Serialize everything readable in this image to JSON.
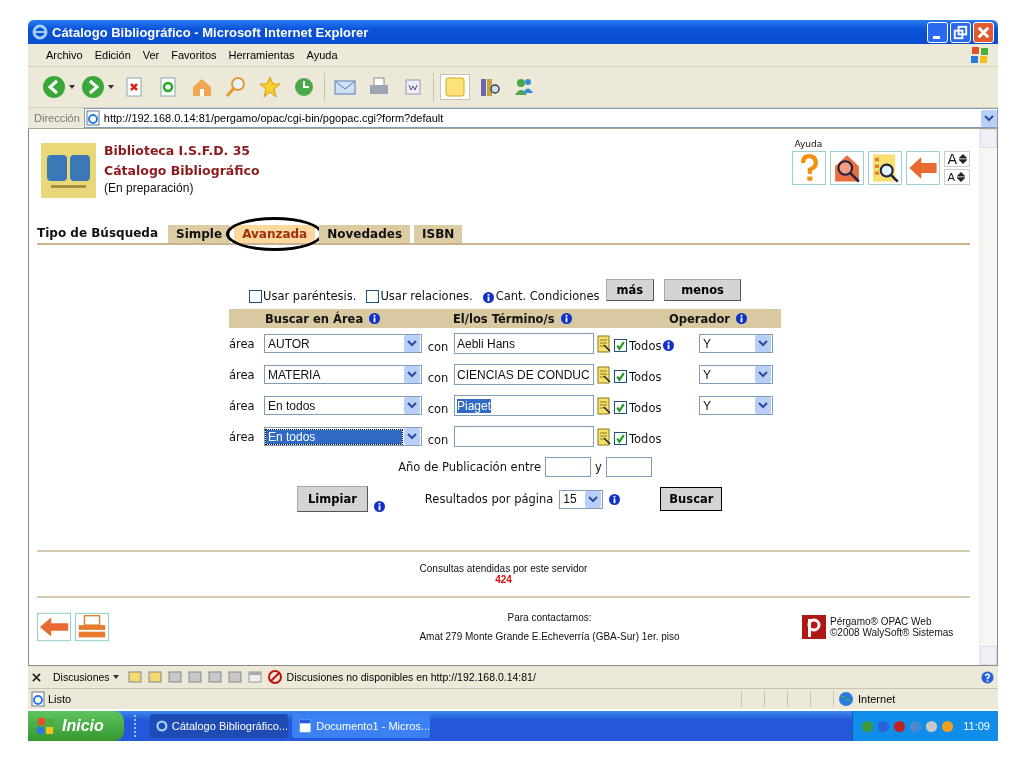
{
  "window": {
    "title": "Cátalogo Bibliográfico - Microsoft Internet Explorer"
  },
  "menu": [
    "Archivo",
    "Edición",
    "Ver",
    "Favoritos",
    "Herramientas",
    "Ayuda"
  ],
  "address": {
    "label": "Dirección",
    "url": "http://192.168.0.14:81/pergamo/opac/cgi-bin/pgopac.cgi?form?default"
  },
  "header": {
    "library": "Biblioteca I.S.F.D. 35",
    "catalog": "Cátalogo Bibliográfico",
    "note": "(En preparación)",
    "help_label": "Ayuda",
    "font_buttons": [
      "A",
      "A"
    ]
  },
  "search_type_label": "Tipo de Búsqueda",
  "tabs": [
    {
      "label": "Simple",
      "selected": false
    },
    {
      "label": "Avanzada",
      "selected": true
    },
    {
      "label": "Novedades",
      "selected": false
    },
    {
      "label": "ISBN",
      "selected": false
    }
  ],
  "options": [
    {
      "label": "Usar paréntesis.",
      "checked": false
    },
    {
      "label": "Usar relaciones.",
      "checked": false
    }
  ],
  "conditions_label": "Cant. Condiciones",
  "condition_buttons": [
    "más",
    "menos"
  ],
  "columns": [
    "Buscar en Área",
    "El/los Término/s",
    "Operador"
  ],
  "rows": [
    {
      "area_label": "área",
      "area": "AUTOR",
      "area_focused": false,
      "con": "con",
      "term": "Aebli Hans",
      "term_selected": false,
      "todos": "Todos",
      "todos_checked": true,
      "info": true,
      "operator": "Y"
    },
    {
      "area_label": "área",
      "area": "MATERIA",
      "area_focused": false,
      "con": "con",
      "term": "CIENCIAS DE CONDUC",
      "term_selected": false,
      "todos": "Todos",
      "todos_checked": true,
      "info": false,
      "operator": "Y"
    },
    {
      "area_label": "área",
      "area": "En todos",
      "area_focused": false,
      "con": "con",
      "term": "Piaget",
      "term_selected": true,
      "todos": "Todos",
      "todos_checked": true,
      "info": false,
      "operator": "Y"
    },
    {
      "area_label": "área",
      "area": "En todos",
      "area_focused": true,
      "con": "con",
      "term_selected": false,
      "todos": "Todos",
      "todos_checked": true,
      "info": false
    }
  ],
  "year": {
    "label": "Año de Publicación entre",
    "and": "y"
  },
  "clear_button": "Limpiar",
  "per_page": {
    "label": "Resultados por página",
    "value": "15"
  },
  "search_button": "Buscar",
  "stats": {
    "label": "Consultas atendidas por este servidor",
    "count": "424"
  },
  "contact": {
    "label": "Para contactarnos:",
    "address": "Amat 279 Monte Grande E.Echeverría (GBA-Sur) 1er. piso"
  },
  "brand": [
    "Pérgamo® OPAC Web",
    "©2008 WalySoft® Sistemas"
  ],
  "discussions": {
    "button": "Discusiones",
    "message": "Discusiones no disponibles en http://192.168.0.14:81/"
  },
  "status": {
    "text": "Listo",
    "zone": "Internet"
  },
  "taskbar": {
    "start": "Inicio",
    "tasks": [
      {
        "label": "Cátalogo Bibliográfico...",
        "selected": true
      },
      {
        "label": "Documento1 - Micros...",
        "selected": false
      }
    ],
    "clock": "11:09"
  }
}
